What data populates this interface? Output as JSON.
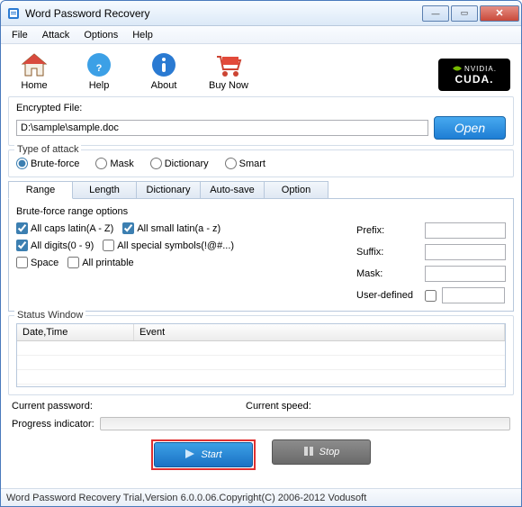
{
  "title": "Word Password Recovery",
  "menu": {
    "file": "File",
    "attack": "Attack",
    "options": "Options",
    "help": "Help"
  },
  "toolbar": {
    "home": "Home",
    "help": "Help",
    "about": "About",
    "buynow": "Buy Now",
    "cuda_top": "NVIDIA.",
    "cuda_bottom": "CUDA."
  },
  "encrypted": {
    "label": "Encrypted File:",
    "path": "D:\\sample\\sample.doc",
    "open": "Open"
  },
  "attack_type": {
    "label": "Type of attack",
    "brute": "Brute-force",
    "mask": "Mask",
    "dict": "Dictionary",
    "smart": "Smart",
    "selected": "brute"
  },
  "tabs": {
    "range": "Range",
    "length": "Length",
    "dictionary": "Dictionary",
    "autosave": "Auto-save",
    "option": "Option"
  },
  "range": {
    "heading": "Brute-force range options",
    "caps": "All caps latin(A - Z)",
    "small": "All small latin(a - z)",
    "digits": "All digits(0 - 9)",
    "special": "All special symbols(!@#...)",
    "space": "Space",
    "printable": "All printable",
    "prefix": "Prefix:",
    "suffix": "Suffix:",
    "mask": "Mask:",
    "userdef": "User-defined",
    "prefix_val": "",
    "suffix_val": "",
    "mask_val": "",
    "userdef_val": ""
  },
  "status": {
    "label": "Status Window",
    "col1": "Date,Time",
    "col2": "Event"
  },
  "bottom": {
    "curpw": "Current password:",
    "curspeed": "Current speed:",
    "progress": "Progress indicator:"
  },
  "actions": {
    "start": "Start",
    "stop": "Stop"
  },
  "statusbar": "Word Password Recovery Trial,Version 6.0.0.06.Copyright(C) 2006-2012 Vodusoft"
}
